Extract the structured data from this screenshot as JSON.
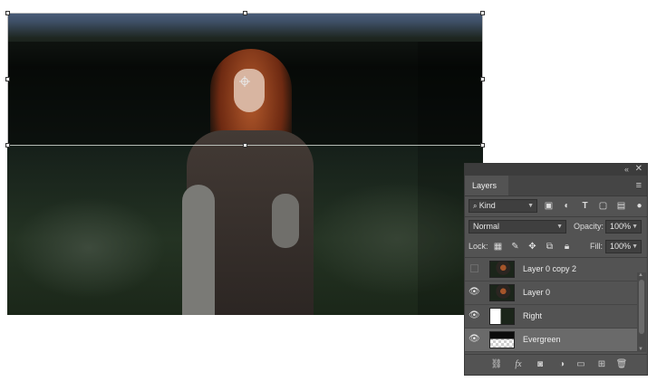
{
  "canvas": {
    "alt": "Portrait photo in evergreen forest"
  },
  "panel": {
    "tab": "Layers",
    "collapse_glyph": "«",
    "close_glyph": "✕",
    "menu_glyph": "≡",
    "filter": {
      "kind": "Kind"
    },
    "blend_mode": "Normal",
    "opacity_label": "Opacity:",
    "opacity_value": "100%",
    "lock_label": "Lock:",
    "fill_label": "Fill:",
    "fill_value": "100%",
    "filter_icons": [
      "image-filter-icon",
      "adjustment-filter-icon",
      "type-filter-icon",
      "shape-filter-icon",
      "smart-object-filter-icon",
      "filter-toggle-icon"
    ],
    "lock_icons": [
      "lock-transparent-icon",
      "lock-image-icon",
      "lock-position-icon",
      "lock-artboard-icon",
      "lock-all-icon"
    ],
    "layers": [
      {
        "name": "Layer 0 copy 2",
        "visible": false,
        "selected": false,
        "thumb": "photo"
      },
      {
        "name": "Layer 0",
        "visible": true,
        "selected": false,
        "thumb": "photo"
      },
      {
        "name": "Right",
        "visible": true,
        "selected": false,
        "thumb": "right"
      },
      {
        "name": "Evergreen",
        "visible": true,
        "selected": true,
        "thumb": "mask"
      }
    ],
    "bottom_icons": [
      "link-layers-icon",
      "fx-icon",
      "add-mask-icon",
      "adjustment-layer-icon",
      "new-group-icon",
      "new-layer-icon",
      "delete-layer-icon"
    ]
  }
}
